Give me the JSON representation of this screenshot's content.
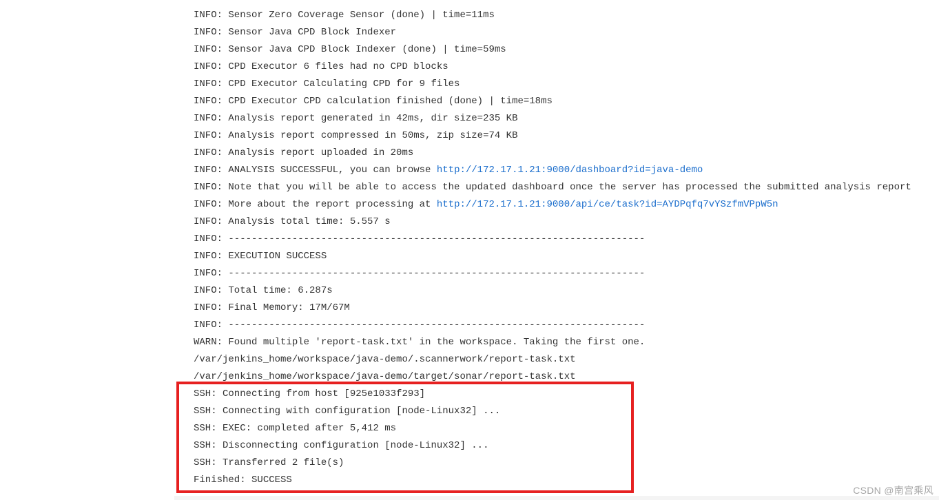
{
  "log_lines": [
    {
      "prefix": "INFO: Sensor Zero Coverage Sensor (done) | time=11ms"
    },
    {
      "prefix": "INFO: Sensor Java CPD Block Indexer"
    },
    {
      "prefix": "INFO: Sensor Java CPD Block Indexer (done) | time=59ms"
    },
    {
      "prefix": "INFO: CPD Executor 6 files had no CPD blocks"
    },
    {
      "prefix": "INFO: CPD Executor Calculating CPD for 9 files"
    },
    {
      "prefix": "INFO: CPD Executor CPD calculation finished (done) | time=18ms"
    },
    {
      "prefix": "INFO: Analysis report generated in 42ms, dir size=235 KB"
    },
    {
      "prefix": "INFO: Analysis report compressed in 50ms, zip size=74 KB"
    },
    {
      "prefix": "INFO: Analysis report uploaded in 20ms"
    },
    {
      "prefix": "INFO: ANALYSIS SUCCESSFUL, you can browse ",
      "link": "http://172.17.1.21:9000/dashboard?id=java-demo"
    },
    {
      "prefix": "INFO: Note that you will be able to access the updated dashboard once the server has processed the submitted analysis report"
    },
    {
      "prefix": "INFO: More about the report processing at ",
      "link": "http://172.17.1.21:9000/api/ce/task?id=AYDPqfq7vYSzfmVPpW5n"
    },
    {
      "prefix": "INFO: Analysis total time: 5.557 s"
    },
    {
      "prefix": "INFO: ------------------------------------------------------------------------"
    },
    {
      "prefix": "INFO: EXECUTION SUCCESS"
    },
    {
      "prefix": "INFO: ------------------------------------------------------------------------"
    },
    {
      "prefix": "INFO: Total time: 6.287s"
    },
    {
      "prefix": "INFO: Final Memory: 17M/67M"
    },
    {
      "prefix": "INFO: ------------------------------------------------------------------------"
    },
    {
      "prefix": "WARN: Found multiple 'report-task.txt' in the workspace. Taking the first one."
    },
    {
      "prefix": "/var/jenkins_home/workspace/java-demo/.scannerwork/report-task.txt"
    },
    {
      "prefix": "/var/jenkins_home/workspace/java-demo/target/sonar/report-task.txt"
    },
    {
      "prefix": "SSH: Connecting from host [925e1033f293]"
    },
    {
      "prefix": "SSH: Connecting with configuration [node-Linux32] ..."
    },
    {
      "prefix": "SSH: EXEC: completed after 5,412 ms"
    },
    {
      "prefix": "SSH: Disconnecting configuration [node-Linux32] ..."
    },
    {
      "prefix": "SSH: Transferred 2 file(s)"
    },
    {
      "prefix": "Finished: SUCCESS"
    }
  ],
  "watermark": "CSDN @南宫乘风"
}
